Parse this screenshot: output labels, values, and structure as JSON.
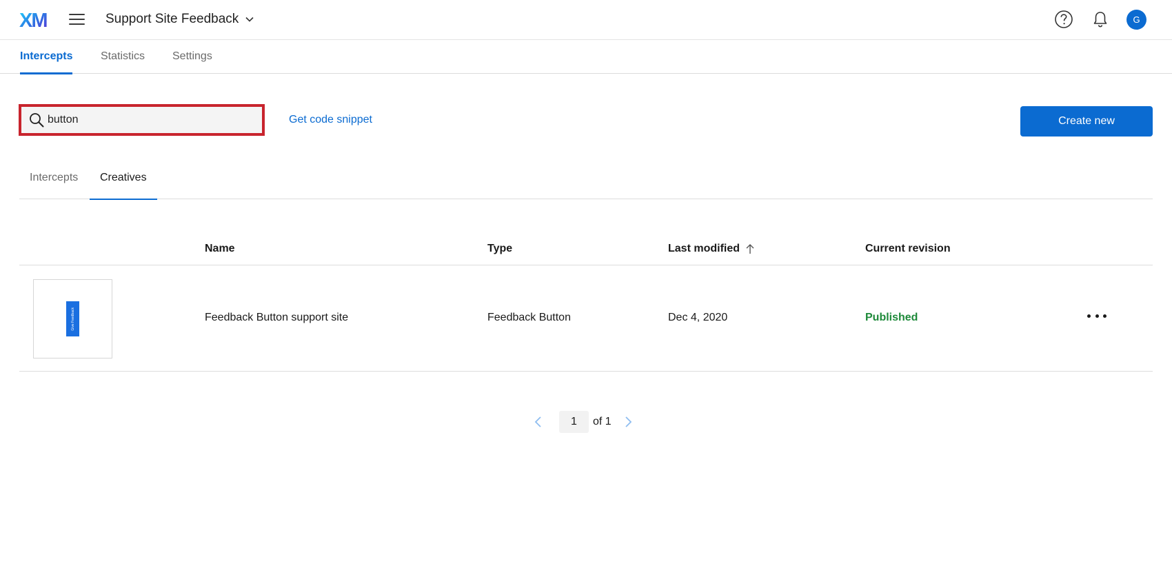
{
  "header": {
    "logo": "XM",
    "project_title": "Support Site Feedback",
    "avatar_initial": "G",
    "icons": [
      "menu-icon",
      "chevron-down-icon",
      "help-icon",
      "bell-icon"
    ]
  },
  "main_tabs": [
    {
      "label": "Intercepts",
      "active": true
    },
    {
      "label": "Statistics",
      "active": false
    },
    {
      "label": "Settings",
      "active": false
    }
  ],
  "toolbar": {
    "search_value": "button",
    "code_snippet_label": "Get code snippet",
    "create_label": "Create new"
  },
  "sub_tabs": [
    {
      "label": "Intercepts",
      "active": false
    },
    {
      "label": "Creatives",
      "active": true
    }
  ],
  "table": {
    "columns": [
      "Name",
      "Type",
      "Last modified",
      "Current revision"
    ],
    "sort_column": "Last modified",
    "sort_direction": "ascending",
    "rows": [
      {
        "thumbnail_text": "Give Feedback",
        "name": "Feedback Button support site",
        "type": "Feedback Button",
        "last_modified": "Dec 4, 2020",
        "revision": "Published"
      }
    ]
  },
  "pagination": {
    "page": "1",
    "of_label": "of 1"
  },
  "colors": {
    "accent": "#0b6bd1",
    "search_highlight": "#c8242d",
    "published": "#1e8a3a"
  }
}
